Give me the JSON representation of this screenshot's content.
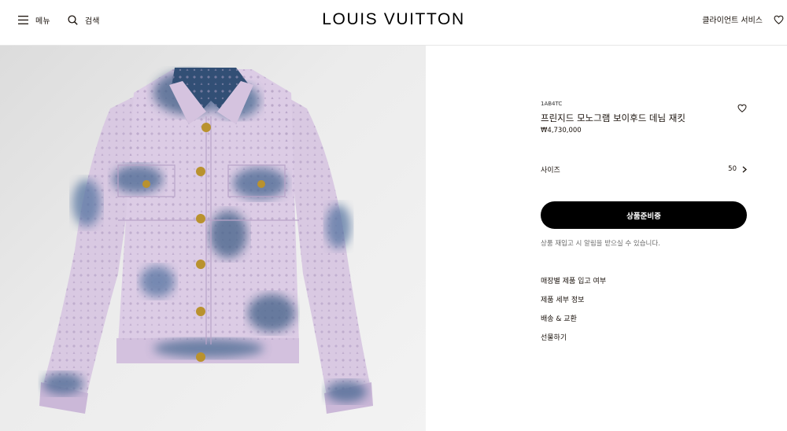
{
  "header": {
    "menu_label": "메뉴",
    "search_label": "검색",
    "logo": "LOUIS VUITTON",
    "client_service": "클라이언트 서비스"
  },
  "product": {
    "sku": "1AB4TC",
    "title": "프린지드 모노그램 보이후드 데님 재킷",
    "price": "₩4,730,000",
    "size_label": "사이즈",
    "size_value": "50",
    "cta_label": "상품준비중",
    "restock_note": "상품 재입고 시 알림을 받으실 수 있습니다.",
    "links": [
      "매장별 제품 입고 여부",
      "제품 세부 정보",
      "배송 & 교환",
      "선물하기"
    ]
  },
  "colors": {
    "cta_bg": "#000000",
    "text": "#19110b",
    "jacket_base": "#d8c6e0",
    "jacket_wash": "#3f5f86"
  },
  "icons": {
    "menu": "hamburger-icon",
    "search": "search-icon",
    "wishlist": "heart-icon",
    "chevron": "chevron-right-icon"
  }
}
